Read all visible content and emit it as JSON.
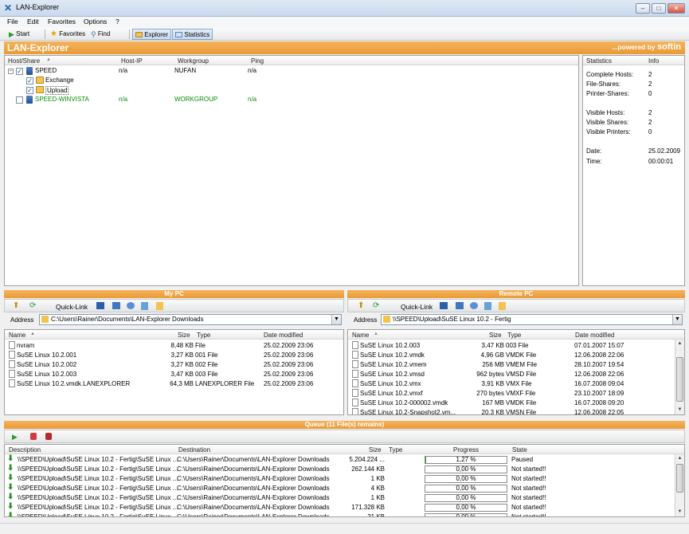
{
  "window": {
    "title": "LAN-Explorer"
  },
  "menu": [
    "File",
    "Edit",
    "Favorites",
    "Options",
    "?"
  ],
  "toolbar": {
    "start": "Start",
    "favorites": "Favorites",
    "find": "Find",
    "explorer": "Explorer",
    "statistics": "Statistics"
  },
  "banner": {
    "title": "LAN-Explorer",
    "powered": "...powered by",
    "brand": "softin"
  },
  "tree": {
    "columns": [
      "Host/Share",
      "Host-IP",
      "Workgroup",
      "Ping"
    ],
    "rows": [
      {
        "name": "SPEED",
        "ip": "n/a",
        "workgroup": "NUFAN",
        "ping": "n/a"
      },
      {
        "name": "Exchange"
      },
      {
        "name": "Upload"
      },
      {
        "name": "SPEED-WINVISTA",
        "ip": "n/a",
        "workgroup": "WORKGROUP",
        "ping": "n/a"
      }
    ]
  },
  "stats": {
    "columns": [
      "Statistics",
      "Info"
    ],
    "rows": [
      {
        "k": "Complete Hosts:",
        "v": "2"
      },
      {
        "k": "File-Shares:",
        "v": "2"
      },
      {
        "k": "Printer-Shares:",
        "v": "0"
      },
      {
        "k": "Visible Hosts:",
        "v": "2"
      },
      {
        "k": "Visible Shares:",
        "v": "2"
      },
      {
        "k": "Visible Printers:",
        "v": "0"
      },
      {
        "k": "Date:",
        "v": "25.02.2009"
      },
      {
        "k": "Time:",
        "v": "00:00:01"
      }
    ]
  },
  "mypc": {
    "title": "My PC",
    "quicklink": "Quick-Link",
    "address_label": "Address",
    "address": "C:\\Users\\Rainer\\Documents\\LAN-Explorer Downloads",
    "columns": [
      "Name",
      "Size",
      "Type",
      "Date modified"
    ],
    "files": [
      {
        "name": "nvram",
        "size": "8,48 KB",
        "type": "File",
        "date": "25.02.2009 23:06"
      },
      {
        "name": "SuSE Linux 10.2.001",
        "size": "3,27 KB",
        "type": "001 File",
        "date": "25.02.2009 23:06"
      },
      {
        "name": "SuSE Linux 10.2.002",
        "size": "3,27 KB",
        "type": "002 File",
        "date": "25.02.2009 23:06"
      },
      {
        "name": "SuSE Linux 10.2.003",
        "size": "3,47 KB",
        "type": "003 File",
        "date": "25.02.2009 23:06"
      },
      {
        "name": "SuSE Linux 10.2.vmdk.LANEXPLORER",
        "size": "64,3 MB",
        "type": "LANEXPLORER File",
        "date": "25.02.2009 23:06"
      }
    ]
  },
  "remote": {
    "title": "Remote PC",
    "quicklink": "Quick-Link",
    "address_label": "Address",
    "address": "\\\\SPEED\\Upload\\SuSE Linux 10.2 - Fertig",
    "columns": [
      "Name",
      "Size",
      "Type",
      "Date modified"
    ],
    "files": [
      {
        "name": "SuSE Linux 10.2.003",
        "size": "3,47 KB",
        "type": "003 File",
        "date": "07.01.2007 15:07"
      },
      {
        "name": "SuSE Linux 10.2.vmdk",
        "size": "4,96 GB",
        "type": "VMDK File",
        "date": "12.06.2008 22:06"
      },
      {
        "name": "SuSE Linux 10.2.vmem",
        "size": "256 MB",
        "type": "VMEM File",
        "date": "28.10.2007 19:54"
      },
      {
        "name": "SuSE Linux 10.2.vmsd",
        "size": "962 bytes",
        "type": "VMSD File",
        "date": "12.06.2008 22:06"
      },
      {
        "name": "SuSE Linux 10.2.vmx",
        "size": "3,91 KB",
        "type": "VMX File",
        "date": "16.07.2008 09:04"
      },
      {
        "name": "SuSE Linux 10.2.vmxf",
        "size": "270 bytes",
        "type": "VMXF File",
        "date": "23.10.2007 18:09"
      },
      {
        "name": "SuSE Linux 10.2-000002.vmdk",
        "size": "167 MB",
        "type": "VMDK File",
        "date": "16.07.2008 09:20"
      },
      {
        "name": "SuSE Linux 10.2-Snapshot2.vm...",
        "size": "20,3 KB",
        "type": "VMSN File",
        "date": "12.06.2008 22:05"
      }
    ]
  },
  "queue": {
    "title": "Queue (11 File(s) remains)",
    "columns": [
      "Description",
      "Destination",
      "Size",
      "Type",
      "Progress",
      "State"
    ],
    "rows": [
      {
        "desc": "\\\\SPEED\\Upload\\SuSE Linux 10.2 - Fertig\\SuSE Linux ...",
        "dest": "C:\\Users\\Rainer\\Documents\\LAN-Explorer Downloads",
        "size": "5.204.224 ...",
        "progress": "1,27 %",
        "pct": 0.0127,
        "state": "Paused"
      },
      {
        "desc": "\\\\SPEED\\Upload\\SuSE Linux 10.2 - Fertig\\SuSE Linux ...",
        "dest": "C:\\Users\\Rainer\\Documents\\LAN-Explorer Downloads",
        "size": "262.144 KB",
        "progress": "0,00 %",
        "pct": 0,
        "state": "Not started!!"
      },
      {
        "desc": "\\\\SPEED\\Upload\\SuSE Linux 10.2 - Fertig\\SuSE Linux ...",
        "dest": "C:\\Users\\Rainer\\Documents\\LAN-Explorer Downloads",
        "size": "1 KB",
        "progress": "0,00 %",
        "pct": 0,
        "state": "Not started!!"
      },
      {
        "desc": "\\\\SPEED\\Upload\\SuSE Linux 10.2 - Fertig\\SuSE Linux ...",
        "dest": "C:\\Users\\Rainer\\Documents\\LAN-Explorer Downloads",
        "size": "4 KB",
        "progress": "0,00 %",
        "pct": 0,
        "state": "Not started!!"
      },
      {
        "desc": "\\\\SPEED\\Upload\\SuSE Linux 10.2 - Fertig\\SuSE Linux ...",
        "dest": "C:\\Users\\Rainer\\Documents\\LAN-Explorer Downloads",
        "size": "1 KB",
        "progress": "0,00 %",
        "pct": 0,
        "state": "Not started!!"
      },
      {
        "desc": "\\\\SPEED\\Upload\\SuSE Linux 10.2 - Fertig\\SuSE Linux ...",
        "dest": "C:\\Users\\Rainer\\Documents\\LAN-Explorer Downloads",
        "size": "171.328 KB",
        "progress": "0,00 %",
        "pct": 0,
        "state": "Not started!!"
      },
      {
        "desc": "\\\\SPEED\\Upload\\SuSE Linux 10.2 - Fertig\\SuSE Linux ...",
        "dest": "C:\\Users\\Rainer\\Documents\\LAN-Explorer Downloads",
        "size": "21 KB",
        "progress": "0,00 %",
        "pct": 0,
        "state": "Not started!!"
      }
    ]
  },
  "colors": {
    "accent": "#e99a35",
    "green": "#0a8a0a",
    "progress": "#2ca02c"
  }
}
